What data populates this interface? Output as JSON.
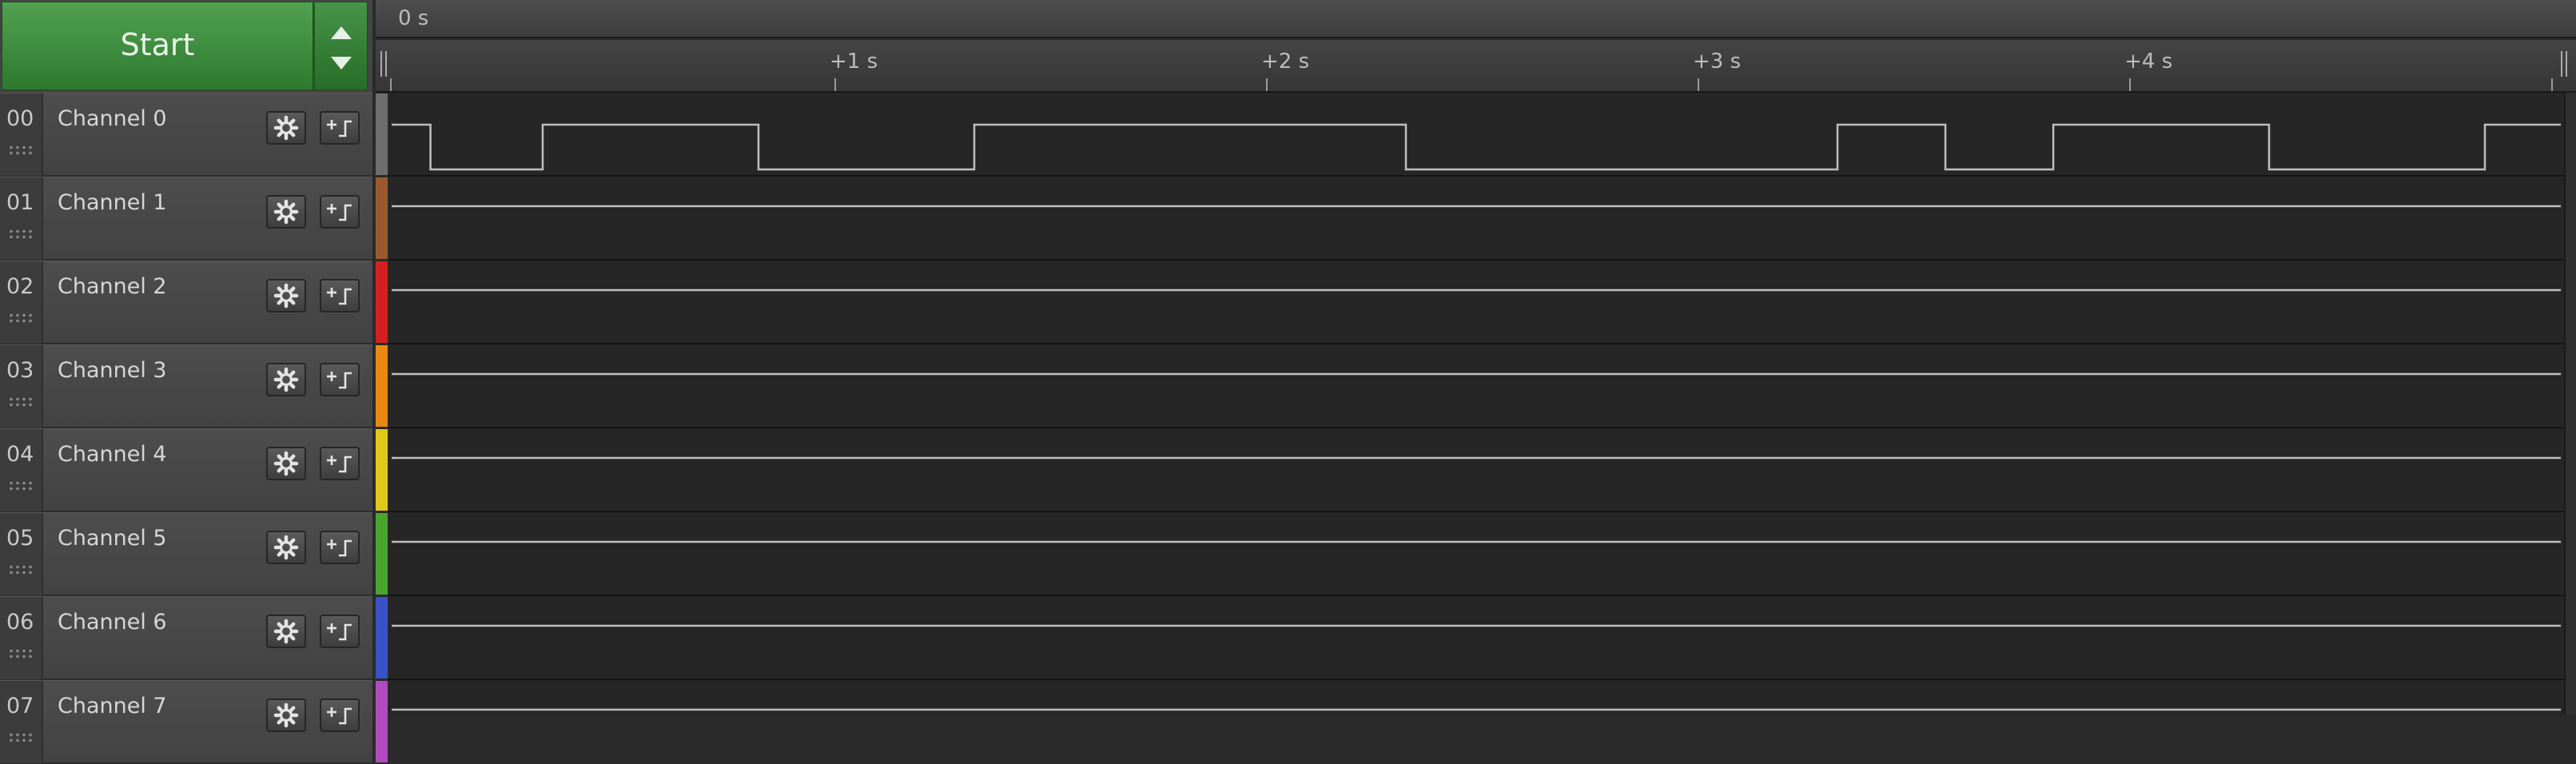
{
  "capture": {
    "start_label": "Start"
  },
  "ruler": {
    "origin_label": "0 s",
    "ticks": [
      "+1 s",
      "+2 s",
      "+3 s",
      "+4 s"
    ]
  },
  "channels": [
    {
      "index": "00",
      "name": "Channel 0",
      "color": "#6e6e6e"
    },
    {
      "index": "01",
      "name": "Channel 1",
      "color": "#9a5a2e"
    },
    {
      "index": "02",
      "name": "Channel 2",
      "color": "#d42020"
    },
    {
      "index": "03",
      "name": "Channel 3",
      "color": "#e88a12"
    },
    {
      "index": "04",
      "name": "Channel 4",
      "color": "#e0c81a"
    },
    {
      "index": "05",
      "name": "Channel 5",
      "color": "#4aa52e"
    },
    {
      "index": "06",
      "name": "Channel 6",
      "color": "#3a52c8"
    },
    {
      "index": "07",
      "name": "Channel 7",
      "color": "#b24ac0"
    }
  ],
  "icons": {
    "settings": "gear-icon",
    "trigger": "trigger-edge-icon",
    "scroll_up": "arrow-up-icon",
    "scroll_down": "arrow-down-icon",
    "reorder": "grip-dots-icon"
  },
  "signal": {
    "channel0_transitions_s": [
      0.09,
      0.35,
      0.85,
      1.35,
      2.35,
      3.35,
      3.6,
      3.85,
      4.35,
      4.85
    ],
    "channel0_initial_level": "high",
    "other_channels_level": "high",
    "trace_color": "#bfbfbf"
  }
}
